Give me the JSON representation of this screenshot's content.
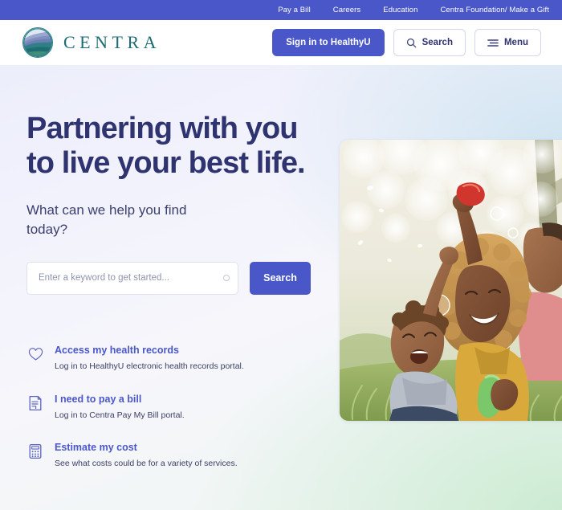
{
  "topbar": {
    "links": [
      {
        "label": "Pay a Bill",
        "name": "topbar-link-pay-a-bill"
      },
      {
        "label": "Careers",
        "name": "topbar-link-careers"
      },
      {
        "label": "Education",
        "name": "topbar-link-education"
      },
      {
        "label": "Centra Foundation/ Make a Gift",
        "name": "topbar-link-foundation"
      }
    ],
    "background_color": "#4a57c9",
    "text_color": "#ffffff"
  },
  "header": {
    "brand_name": "CENTRA",
    "logo_icon": "centra-circle-landscape-logo",
    "brand_color": "#1d6b73",
    "signin_label": "Sign in to HealthyU",
    "search_label": "Search",
    "search_icon": "search-icon",
    "menu_label": "Menu",
    "menu_icon": "hamburger-menu-icon",
    "primary_color": "#4a57c9"
  },
  "hero": {
    "headline": "Partnering with you to live your best life.",
    "subhead": "What can we help you find today?",
    "headline_color": "#2f3470",
    "search": {
      "placeholder": "Enter a keyword to get started...",
      "value": "",
      "button_label": "Search",
      "field_icon": "circle-icon"
    },
    "photo_alt": "Family sitting in grass outdoors blowing bubbles"
  },
  "quick_links": [
    {
      "icon": "heart-icon",
      "title": "Access my health records",
      "description": "Log in to HealthyU electronic health records portal."
    },
    {
      "icon": "document-bill-icon",
      "title": "I need to pay a bill",
      "description": "Log in to Centra Pay My Bill portal."
    },
    {
      "icon": "calculator-icon",
      "title": "Estimate my cost",
      "description": "See what costs could be for a variety of services."
    }
  ]
}
